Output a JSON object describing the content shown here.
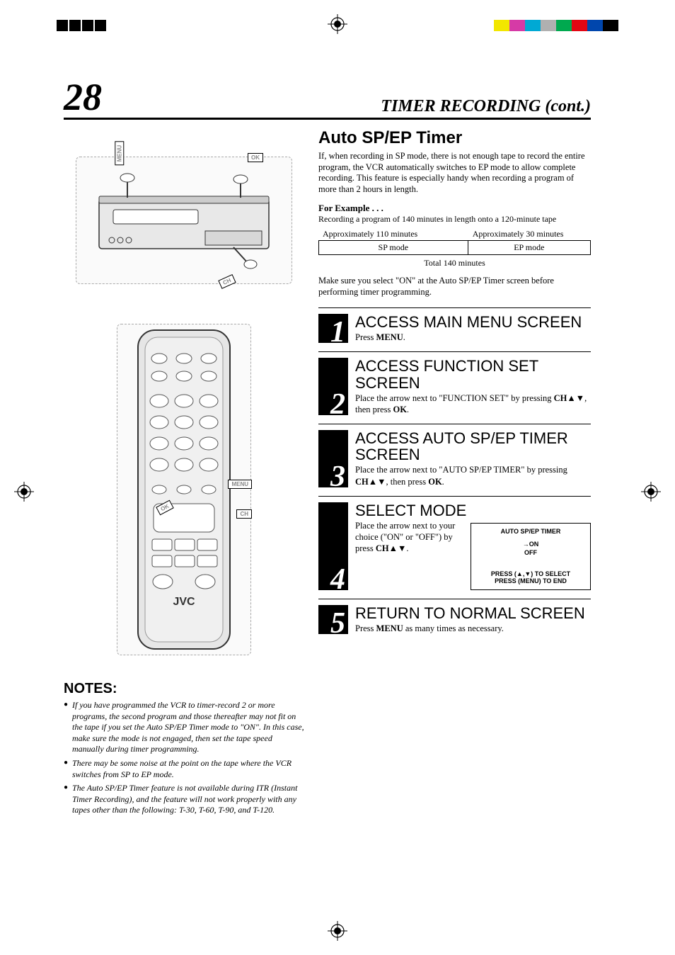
{
  "page_number": "28",
  "section_title": "TIMER RECORDING (cont.)",
  "feature_title": "Auto SP/EP Timer",
  "intro_text": "If, when recording in SP mode, there is not enough tape to record the entire program, the VCR automatically switches to EP mode to allow complete recording. This feature is especially handy when recording a program of more than 2 hours in length.",
  "example": {
    "heading": "For Example . . .",
    "sub": "Recording a program of 140 minutes in length onto a 120-minute tape",
    "col1_top": "Approximately 110 minutes",
    "col2_top": "Approximately 30 minutes",
    "col1_mode": "SP mode",
    "col2_mode": "EP mode",
    "total": "Total 140 minutes"
  },
  "pre_note": "Make sure you select \"ON\" at the Auto SP/EP Timer screen before performing timer programming.",
  "steps": [
    {
      "num": "1",
      "title": "ACCESS MAIN MENU SCREEN",
      "text": "Press <b>MENU</b>."
    },
    {
      "num": "2",
      "title": "ACCESS FUNCTION SET SCREEN",
      "text": "Place the arrow next to \"FUNCTION SET\" by pressing <b>CH</b>▲▼, then press <b>OK</b>."
    },
    {
      "num": "3",
      "title": "ACCESS AUTO SP/EP TIMER SCREEN",
      "text": "Place the arrow next to \"AUTO SP/EP TIMER\" by pressing <b>CH</b>▲▼, then press <b>OK</b>."
    },
    {
      "num": "4",
      "title": "SELECT MODE",
      "text": "Place the arrow next to your choice (\"ON\" or \"OFF\") by press <b>CH</b>▲▼."
    },
    {
      "num": "5",
      "title": "RETURN TO NORMAL SCREEN",
      "text": "Press <b>MENU</b> as many times as necessary."
    }
  ],
  "osd": {
    "title": "AUTO SP/EP TIMER",
    "opt1": "→ON",
    "opt2": "OFF",
    "hint1": "PRESS (▲,▼) TO SELECT",
    "hint2": "PRESS (MENU) TO END"
  },
  "notes_heading": "NOTES:",
  "notes": [
    "If you have programmed the VCR to timer-record 2 or more programs, the second program and those thereafter may not fit on the tape if you set the Auto SP/EP Timer mode to \"ON\". In this case, make sure the mode is not engaged, then set the tape speed manually during timer programming.",
    "There may be some noise at the point on the tape where the VCR switches from SP to EP mode.",
    "The Auto SP/EP Timer feature is not available during ITR (Instant Timer Recording), and the feature will not work properly with any tapes other than the following:  T-30, T-60, T-90, and T-120."
  ],
  "illustration_labels": {
    "menu": "MENU",
    "ok": "OK",
    "ch": "CH",
    "brand": "JVC"
  },
  "reg_colors": [
    "#f2e600",
    "#d63aa6",
    "#00a9d4",
    "#b0b0b0",
    "#00a94f",
    "#e30613",
    "#0046ad",
    "#000000"
  ]
}
